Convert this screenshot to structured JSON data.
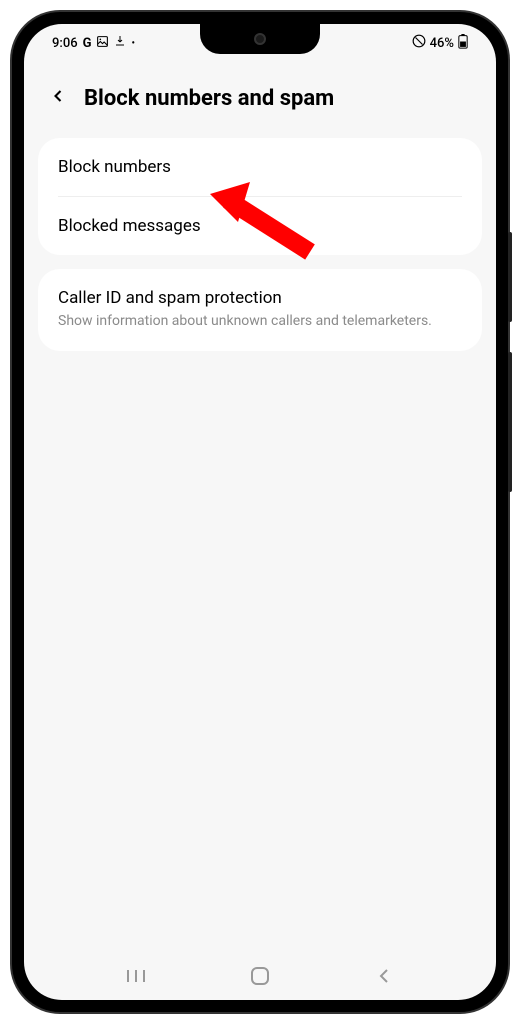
{
  "status_bar": {
    "time": "9:06",
    "left_icons": [
      "G",
      "🖼",
      "⬇",
      "•"
    ],
    "battery_text": "46%",
    "right_icons": [
      "⊘"
    ]
  },
  "header": {
    "title": "Block numbers and spam"
  },
  "section1": {
    "item1": {
      "title": "Block numbers"
    },
    "item2": {
      "title": "Blocked messages"
    }
  },
  "section2": {
    "item1": {
      "title": "Caller ID and spam protection",
      "subtitle": "Show information about unknown callers and telemarketers."
    }
  }
}
